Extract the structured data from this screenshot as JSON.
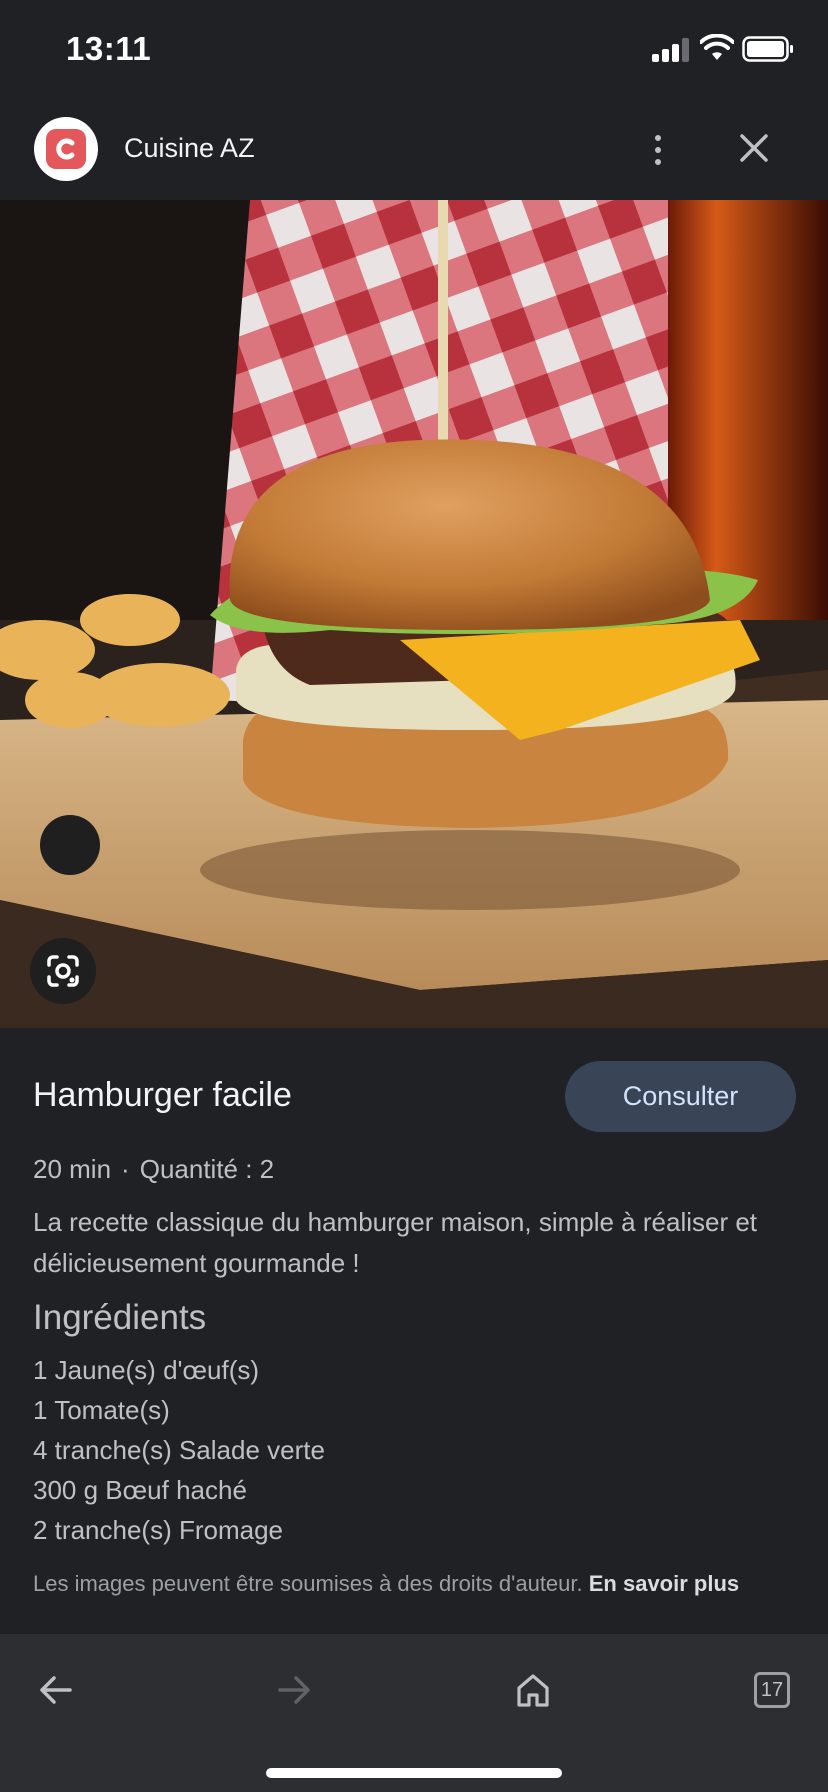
{
  "status_bar": {
    "time": "13:11"
  },
  "header": {
    "site_name": "Cuisine AZ",
    "logo_letter": "c"
  },
  "hero": {
    "image": "photo of a cheeseburger with fries on a wooden board"
  },
  "recipe": {
    "title": "Hamburger facile",
    "visit_label": "Consulter",
    "duration": "20 min",
    "separator": "·",
    "quantity": "Quantité : 2",
    "description": "La recette classique du hamburger maison, simple à réaliser et délicieusement gourmande !",
    "ingredients_title": "Ingrédients",
    "ingredients": [
      "1 Jaune(s) d'œuf(s)",
      "1 Tomate(s)",
      "4 tranche(s) Salade verte",
      "300 g Bœuf haché",
      "2 tranche(s) Fromage"
    ],
    "disclaimer": "Les images peuvent être soumises à des droits d'auteur.",
    "learn_more": "En savoir plus"
  },
  "toolbar": {
    "tab_count": "17"
  },
  "colors": {
    "background": "#202124",
    "button": "#394457",
    "logo": "#e4575a"
  }
}
